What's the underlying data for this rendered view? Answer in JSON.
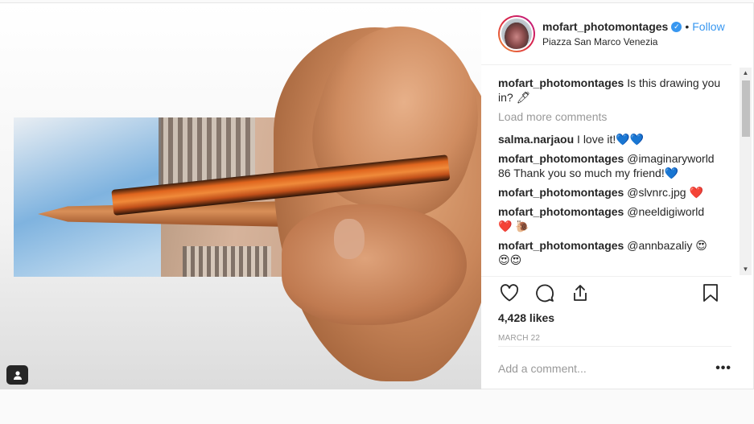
{
  "header": {
    "username": "mofart_photomontages",
    "verified_badge": "✓",
    "separator": "•",
    "follow_label": "Follow",
    "location": "Piazza San Marco Venezia"
  },
  "caption": {
    "username": "mofart_photomontages",
    "text": "Is this drawing you in? 🖊"
  },
  "load_more_label": "Load more comments",
  "comments": [
    {
      "username": "salma.narjaou",
      "text": "I love it!💙💙"
    },
    {
      "username": "mofart_photomontages",
      "text": "@imaginaryworld 86 Thank you so much my friend!💙"
    },
    {
      "username": "mofart_photomontages",
      "text": "@slvnrc.jpg ❤️"
    },
    {
      "username": "mofart_photomontages",
      "text": "@neeldigiworld ❤️ 🐌"
    },
    {
      "username": "mofart_photomontages",
      "text": "@annbazaliy 😍 😍😍"
    }
  ],
  "likes": "4,428 likes",
  "date": "MARCH 22",
  "add_comment_placeholder": "Add a comment...",
  "more_options": "•••",
  "icons": {
    "like": "heart-icon",
    "comment": "speech-bubble-icon",
    "share": "share-icon",
    "save": "bookmark-icon",
    "user_tag": "user-tag-icon"
  },
  "colors": {
    "accent": "#3897f0",
    "text": "#262626",
    "muted": "#999999"
  }
}
